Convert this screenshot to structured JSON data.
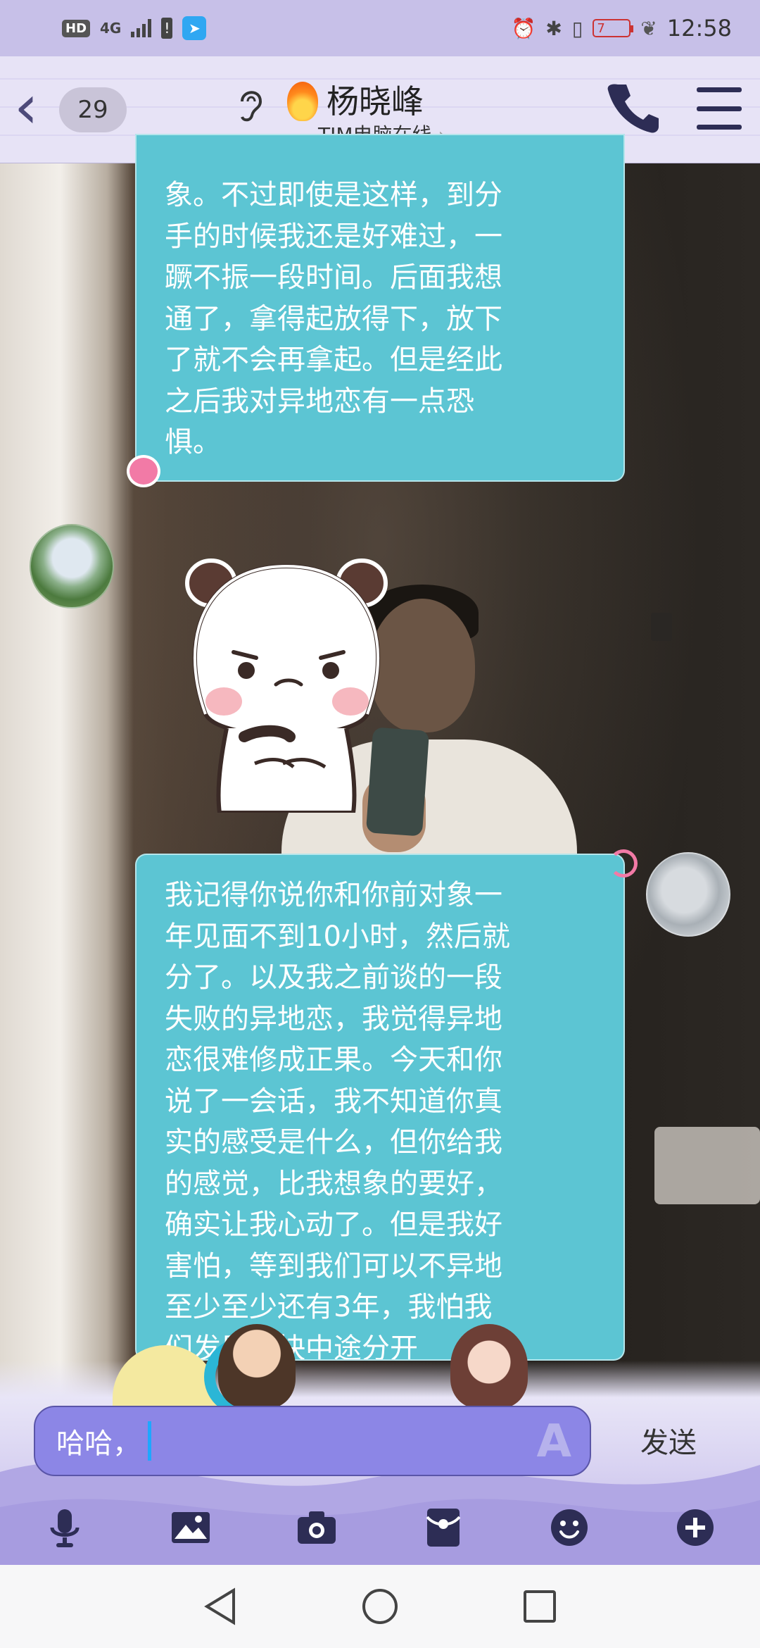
{
  "status_bar": {
    "hd": "HD",
    "network": "4G",
    "battery": "7",
    "time": "12:58",
    "icons": [
      "hd-icon",
      "signal-icon",
      "alert-icon",
      "app-notification-icon",
      "alarm-icon",
      "bluetooth-icon",
      "vibrate-icon",
      "battery-icon",
      "leaf-icon"
    ]
  },
  "header": {
    "unread_count": "29",
    "contact_name": "杨晓峰",
    "status": "TIM电脑在线",
    "status_chevron": "›"
  },
  "messages": [
    {
      "side": "left",
      "text": "象。不过即使是这样，到分\n手的时候我还是好难过，一\n蹶不振一段时间。后面我想\n通了，拿得起放得下，放下\n了就不会再拿起。但是经此\n之后我对异地恋有一点恐\n惧。"
    },
    {
      "side": "left",
      "type": "sticker",
      "sticker": "sad-panda-sticker"
    },
    {
      "side": "right",
      "text": "我记得你说你和你前对象一\n年见面不到10小时，然后就\n分了。以及我之前谈的一段\n失败的异地恋，我觉得异地\n恋很难修成正果。今天和你\n说了一会话，我不知道你真\n实的感受是什么，但你给我\n的感觉，比我想象的要好，\n确实让我心动了。但是我好\n害怕，等到我们可以不异地\n至少至少还有3年，我怕我\n们发展太快中途分开"
    }
  ],
  "input": {
    "value": "哈哈，",
    "send_label": "发送"
  },
  "toolbar": {
    "items": [
      "microphone-icon",
      "image-icon",
      "camera-icon",
      "red-packet-icon",
      "emoji-icon",
      "plus-icon"
    ]
  },
  "colors": {
    "bubble": "#5cc5d3",
    "header_bg": "#e5e1f5",
    "status_bg": "#c7c0e8",
    "input_bg": "#8c86e6",
    "toolbar_icon": "#2d2d55"
  }
}
